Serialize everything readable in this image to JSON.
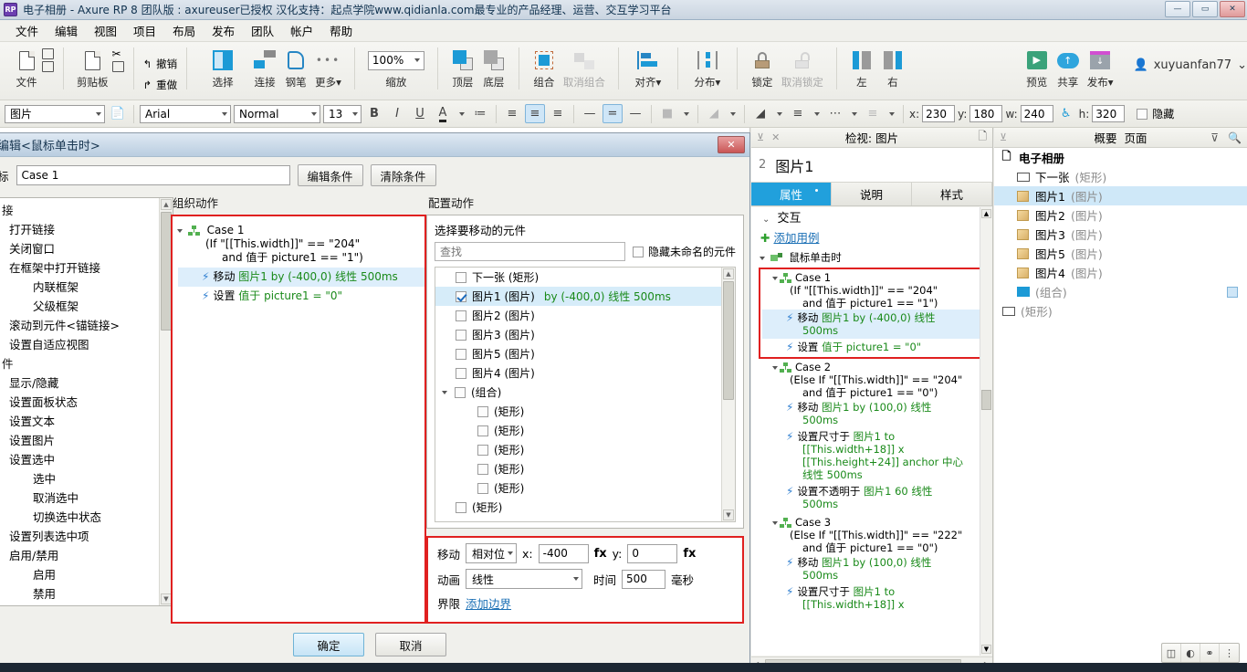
{
  "titlebar": {
    "app_icon": "axure-icon",
    "title": "电子相册 - Axure RP 8 团队版 : axureuser已授权 汉化支持：起点学院www.qidianla.com最专业的产品经理、运营、交互学习平台",
    "minimize": "—",
    "maximize": "▭",
    "close": "✕"
  },
  "menubar": {
    "items": [
      "文件",
      "编辑",
      "视图",
      "项目",
      "布局",
      "发布",
      "团队",
      "帐户",
      "帮助"
    ]
  },
  "toolbar": {
    "groups": [
      {
        "label": "文件",
        "name": "file"
      },
      {
        "label": "剪贴板",
        "name": "clipboard"
      },
      {
        "label": "撤销",
        "name": "undo"
      },
      {
        "label": "重做",
        "name": "redo"
      },
      {
        "label": "选择",
        "name": "select"
      },
      {
        "label": "连接",
        "name": "connect"
      },
      {
        "label": "钢笔",
        "name": "pen"
      },
      {
        "label": "更多",
        "name": "more",
        "caret": "▾"
      },
      {
        "label": "缩放",
        "name": "zoom"
      },
      {
        "label": "顶层",
        "name": "bring-front"
      },
      {
        "label": "底层",
        "name": "send-back"
      },
      {
        "label": "组合",
        "name": "group"
      },
      {
        "label": "取消组合",
        "name": "ungroup",
        "disabled": true
      },
      {
        "label": "对齐",
        "name": "align",
        "caret": "▾"
      },
      {
        "label": "分布",
        "name": "distribute",
        "caret": "▾"
      },
      {
        "label": "锁定",
        "name": "lock"
      },
      {
        "label": "取消锁定",
        "name": "unlock",
        "disabled": true
      },
      {
        "label": "左",
        "name": "left"
      },
      {
        "label": "右",
        "name": "right"
      },
      {
        "label": "预览",
        "name": "preview"
      },
      {
        "label": "共享",
        "name": "share"
      },
      {
        "label": "发布",
        "name": "publish",
        "caret": "▾"
      }
    ],
    "zoom_value": "100%",
    "account": "xuyuanfan77",
    "account_caret": "⌄"
  },
  "formatbar": {
    "widget_type": "图片",
    "font_family": "Arial",
    "font_style": "Normal",
    "font_size": "13",
    "bold": "B",
    "italic": "I",
    "underline": "U",
    "text_color": "A",
    "list": "≔",
    "x_label": "x:",
    "x_value": "230",
    "y_label": "y:",
    "y_value": "180",
    "w_label": "w:",
    "w_value": "240",
    "h_label": "h:",
    "h_value": "320",
    "hidden_label": "隐藏"
  },
  "dialog": {
    "title": "编辑<鼠标单击时>",
    "close": "✕",
    "case_label": "标",
    "case_name": "Case 1",
    "edit_condition": "编辑条件",
    "clear_condition": "清除条件",
    "col1_header": "",
    "col2_header": "组织动作",
    "col3_header": "配置动作",
    "action_list": [
      {
        "text": "接",
        "type": "header"
      },
      {
        "text": "打开链接",
        "type": "item"
      },
      {
        "text": "关闭窗口",
        "type": "item"
      },
      {
        "text": "在框架中打开链接",
        "type": "item"
      },
      {
        "text": "内联框架",
        "type": "sub"
      },
      {
        "text": "父级框架",
        "type": "sub"
      },
      {
        "text": "滚动到元件<锚链接>",
        "type": "item"
      },
      {
        "text": "设置自适应视图",
        "type": "item"
      },
      {
        "text": "件",
        "type": "header"
      },
      {
        "text": "显示/隐藏",
        "type": "item"
      },
      {
        "text": "设置面板状态",
        "type": "item"
      },
      {
        "text": "设置文本",
        "type": "item"
      },
      {
        "text": "设置图片",
        "type": "item"
      },
      {
        "text": "设置选中",
        "type": "item"
      },
      {
        "text": "选中",
        "type": "sub"
      },
      {
        "text": "取消选中",
        "type": "sub"
      },
      {
        "text": "切换选中状态",
        "type": "sub"
      },
      {
        "text": "设置列表选中项",
        "type": "item"
      },
      {
        "text": "启用/禁用",
        "type": "item"
      },
      {
        "text": "启用",
        "type": "sub"
      },
      {
        "text": "禁用",
        "type": "sub"
      }
    ],
    "organize": {
      "case_label": "Case 1",
      "condition_line1": "(If \"[[This.width]]\" == \"204\"",
      "condition_line2": "and 值于 picture1 == \"1\")",
      "actions": [
        {
          "verb": "移动",
          "target": "图片1",
          "mid": "by (-400,0)",
          "easing": "线性",
          "time": "500ms",
          "selected": true
        },
        {
          "verb": "设置",
          "target": "值于",
          "mid": "picture1 = \"0\"",
          "easing": "",
          "time": "",
          "selected": false
        }
      ]
    },
    "configure": {
      "select_label": "选择要移动的元件",
      "search_placeholder": "查找",
      "hide_unnamed_label": "隐藏未命名的元件",
      "widgets": [
        {
          "label": "下一张 (矩形)",
          "checked": false,
          "indent": 0,
          "selected": false,
          "suffix": ""
        },
        {
          "label": "图片1 (图片)",
          "checked": true,
          "indent": 0,
          "selected": true,
          "suffix": "by (-400,0) 线性 500ms"
        },
        {
          "label": "图片2 (图片)",
          "checked": false,
          "indent": 0,
          "selected": false,
          "suffix": ""
        },
        {
          "label": "图片3 (图片)",
          "checked": false,
          "indent": 0,
          "selected": false,
          "suffix": ""
        },
        {
          "label": "图片5 (图片)",
          "checked": false,
          "indent": 0,
          "selected": false,
          "suffix": ""
        },
        {
          "label": "图片4 (图片)",
          "checked": false,
          "indent": 0,
          "selected": false,
          "suffix": ""
        },
        {
          "label": "(组合)",
          "checked": false,
          "indent": 0,
          "selected": false,
          "suffix": "",
          "expandable": true
        },
        {
          "label": "(矩形)",
          "checked": false,
          "indent": 1,
          "selected": false,
          "suffix": ""
        },
        {
          "label": "(矩形)",
          "checked": false,
          "indent": 1,
          "selected": false,
          "suffix": ""
        },
        {
          "label": "(矩形)",
          "checked": false,
          "indent": 1,
          "selected": false,
          "suffix": ""
        },
        {
          "label": "(矩形)",
          "checked": false,
          "indent": 1,
          "selected": false,
          "suffix": ""
        },
        {
          "label": "(矩形)",
          "checked": false,
          "indent": 1,
          "selected": false,
          "suffix": ""
        },
        {
          "label": "(矩形)",
          "checked": false,
          "indent": 0,
          "selected": false,
          "suffix": ""
        }
      ],
      "move_label": "移动",
      "move_mode": "相对位",
      "x_label": "x:",
      "x_value": "-400",
      "fx1": "fx",
      "y_label": "y:",
      "y_value": "0",
      "fx2": "fx",
      "anim_label": "动画",
      "anim_value": "线性",
      "time_label": "时间",
      "time_value": "500",
      "time_unit": "毫秒",
      "bound_label": "界限",
      "bound_link": "添加边界"
    },
    "ok": "确定",
    "cancel": "取消"
  },
  "inspector": {
    "header": "检视: 图片",
    "doc_icon": "document-icon",
    "num": "2",
    "name": "图片1",
    "tabs": [
      {
        "label": "属性",
        "active": true
      },
      {
        "label": "说明",
        "active": false
      },
      {
        "label": "样式",
        "active": false
      }
    ],
    "section": "交互",
    "add_case": "添加用例",
    "event": "鼠标单击时",
    "cases": [
      {
        "name": "Case 1",
        "cond1": "(If \"[[This.width]]\" == \"204\"",
        "cond2": "and 值于 picture1 == \"1\")",
        "highlighted": true,
        "actions": [
          {
            "verb": "移动",
            "rest": "图片1 by (-400,0) 线性",
            "rest2": "500ms",
            "selected": true
          },
          {
            "verb": "设置",
            "rest": "值于 picture1 = \"0\"",
            "rest2": "",
            "selected": false
          }
        ]
      },
      {
        "name": "Case 2",
        "cond1": "(Else If \"[[This.width]]\" == \"204\"",
        "cond2": "and 值于 picture1 == \"0\")",
        "highlighted": false,
        "actions": [
          {
            "verb": "移动",
            "rest": "图片1 by (100,0) 线性",
            "rest2": "500ms",
            "selected": false
          },
          {
            "verb": "设置尺寸于",
            "rest": "图片1 to",
            "rest2": "[[This.width+18]] x",
            "rest3": "[[This.height+24]] anchor 中心",
            "rest4": "线性 500ms",
            "selected": false
          },
          {
            "verb": "设置不透明于",
            "rest": "图片1 60 线性",
            "rest2": "500ms",
            "selected": false
          }
        ]
      },
      {
        "name": "Case 3",
        "cond1": "(Else If \"[[This.width]]\" == \"222\"",
        "cond2": "and 值于 picture1 == \"0\")",
        "highlighted": false,
        "actions": [
          {
            "verb": "移动",
            "rest": "图片1 by (100,0) 线性",
            "rest2": "500ms",
            "selected": false
          },
          {
            "verb": "设置尺寸于",
            "rest": "图片1 to",
            "rest2": "[[This.width+18]] x",
            "selected": false
          }
        ]
      }
    ]
  },
  "outline": {
    "header_outline": "概要",
    "header_pages": "页面",
    "filter_icon": "filter-icon",
    "search_icon": "search-icon",
    "root": "电子相册",
    "items": [
      {
        "label": "下一张",
        "type": "(矩形)",
        "icon": "rect-icon",
        "selected": false,
        "indent": 1
      },
      {
        "label": "图片1",
        "type": "(图片)",
        "icon": "image-icon",
        "selected": true,
        "indent": 1
      },
      {
        "label": "图片2",
        "type": "(图片)",
        "icon": "image-icon",
        "selected": false,
        "indent": 1
      },
      {
        "label": "图片3",
        "type": "(图片)",
        "icon": "image-icon",
        "selected": false,
        "indent": 1
      },
      {
        "label": "图片5",
        "type": "(图片)",
        "icon": "image-icon",
        "selected": false,
        "indent": 1
      },
      {
        "label": "图片4",
        "type": "(图片)",
        "icon": "image-icon",
        "selected": false,
        "indent": 1
      },
      {
        "label": "",
        "type": "(组合)",
        "icon": "folder-icon",
        "selected": false,
        "indent": 1
      },
      {
        "label": "",
        "type": "(矩形)",
        "icon": "rect-icon",
        "selected": false,
        "indent": 0
      }
    ],
    "mini_buttons": [
      "layout-icon",
      "contrast-icon",
      "key-icon",
      "grid-icon"
    ]
  },
  "colors": {
    "accent_blue": "#21a0dc",
    "highlight_red": "#e02020",
    "selection_blue": "#d6ecf9",
    "green_text": "#1a8a1a",
    "link_blue": "#1a6fb5"
  }
}
